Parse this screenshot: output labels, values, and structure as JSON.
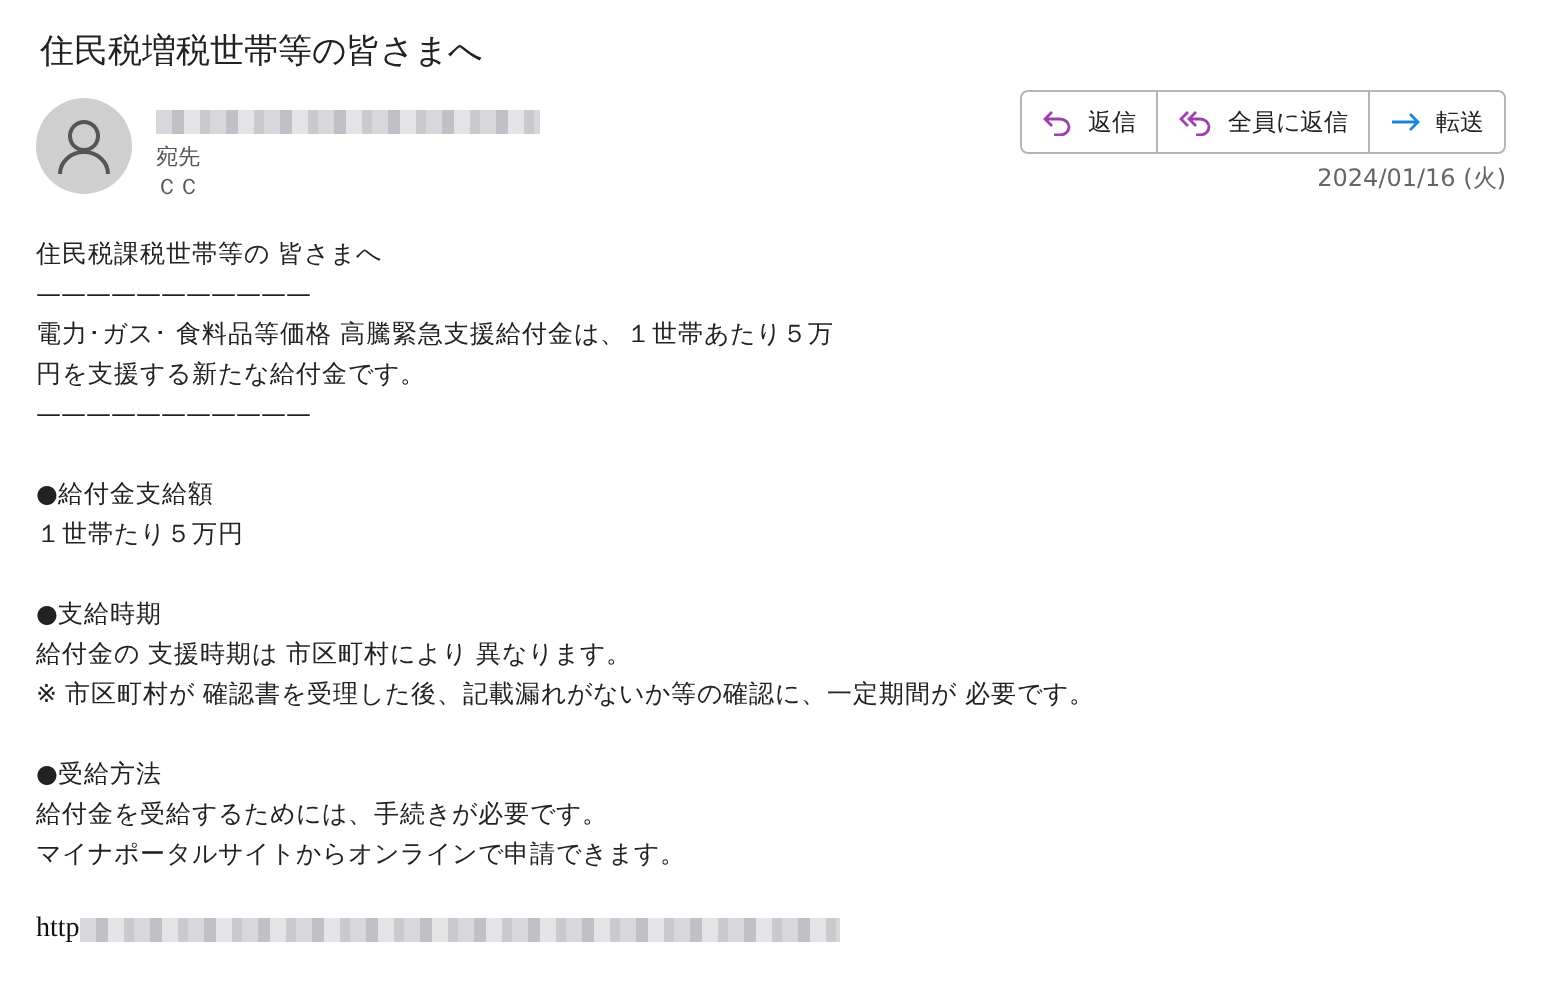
{
  "subject": "住民税増税世帯等の皆さまへ",
  "recipients": [
    {
      "label": "宛先"
    },
    {
      "label": "ＣＣ"
    }
  ],
  "actions": [
    {
      "kind": "reply",
      "label": "返信"
    },
    {
      "kind": "reply_all",
      "label": "全員に返信"
    },
    {
      "kind": "forward",
      "label": "転送"
    }
  ],
  "date": "2024/01/16 (火)",
  "body": [
    {
      "lines": [
        "住民税課税世帯等の 皆さまへ",
        "———————————",
        "電力･ガス･ 食料品等価格 高騰緊急支援給付金は、１世帯あたり５万",
        "円を支援する新たな給付金です。",
        "———————————"
      ]
    },
    {
      "lines": [
        "●給付金支給額",
        "１世帯たり５万円"
      ]
    },
    {
      "lines": [
        "●支給時期",
        "給付金の 支援時期は 市区町村により 異なります。",
        "※ 市区町村が 確認書を受理した後、記載漏れがないか等の確認に、一定期間が 必要です。"
      ]
    },
    {
      "lines": [
        "●受給方法",
        "給付金を受給するためには、手続きが必要です。",
        "マイナポータルサイトからオンラインで申請できます。"
      ]
    }
  ],
  "link": {
    "text": "http"
  }
}
